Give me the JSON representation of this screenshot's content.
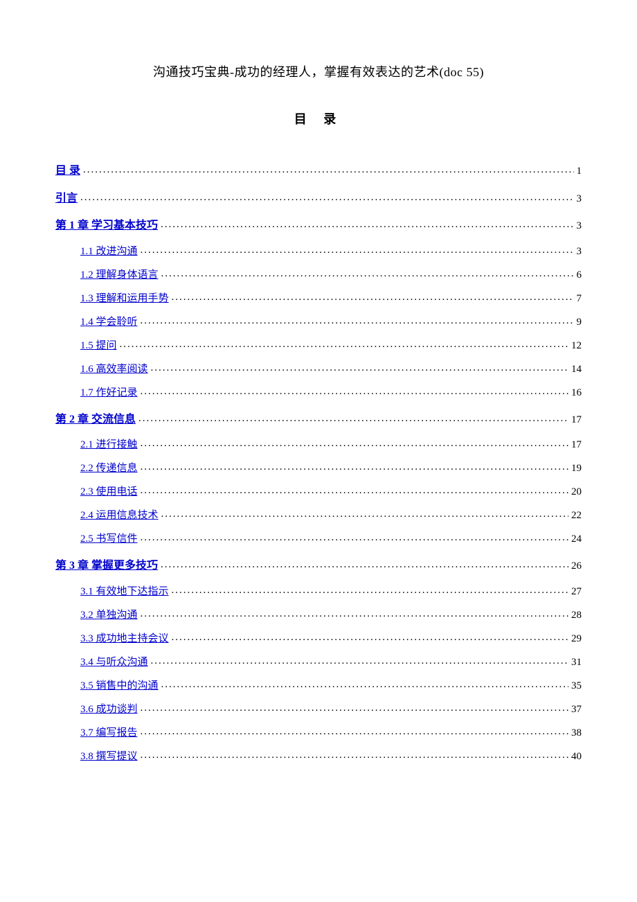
{
  "doc_title": "沟通技巧宝典-成功的经理人，掌握有效表达的艺术(doc 55)",
  "toc_title": "目 录",
  "toc": [
    {
      "label": "目   录",
      "page": "1",
      "level": 0
    },
    {
      "label": "引言",
      "page": "3",
      "level": 0
    },
    {
      "label": "第 1 章      学习基本技巧",
      "page": "3",
      "level": 0,
      "children": [
        {
          "label": "1.1 改进沟通",
          "page": "3"
        },
        {
          "label": "1.2 理解身体语言",
          "page": "6"
        },
        {
          "label": "1.3 理解和运用手势",
          "page": "7"
        },
        {
          "label": "1.4 学会聆听",
          "page": "9"
        },
        {
          "label": "1.5 提问",
          "page": "12"
        },
        {
          "label": "1.6 高效率阅读",
          "page": "14"
        },
        {
          "label": "1.7 作好记录",
          "page": "16"
        }
      ]
    },
    {
      "label": "第 2 章      交流信息",
      "page": "17",
      "level": 0,
      "children": [
        {
          "label": "2.1 进行接触",
          "page": "17"
        },
        {
          "label": "2.2 传递信息",
          "page": "19"
        },
        {
          "label": "2.3 使用电话",
          "page": "20"
        },
        {
          "label": "2.4 运用信息技术",
          "page": "22"
        },
        {
          "label": "2.5 书写信件",
          "page": "24"
        }
      ]
    },
    {
      "label": "第 3 章      掌握更多技巧",
      "page": "26",
      "level": 0,
      "children": [
        {
          "label": "3.1 有效地下达指示",
          "page": "27"
        },
        {
          "label": "3.2 单独沟通",
          "page": "28"
        },
        {
          "label": "3.3 成功地主持会议",
          "page": "29"
        },
        {
          "label": "3.4 与听众沟通",
          "page": "31"
        },
        {
          "label": "3.5 销售中的沟通",
          "page": "35"
        },
        {
          "label": "3.6 成功谈判",
          "page": "37"
        },
        {
          "label": "3.7 编写报告",
          "page": "38"
        },
        {
          "label": "3.8 撰写提议",
          "page": "40"
        }
      ]
    }
  ]
}
